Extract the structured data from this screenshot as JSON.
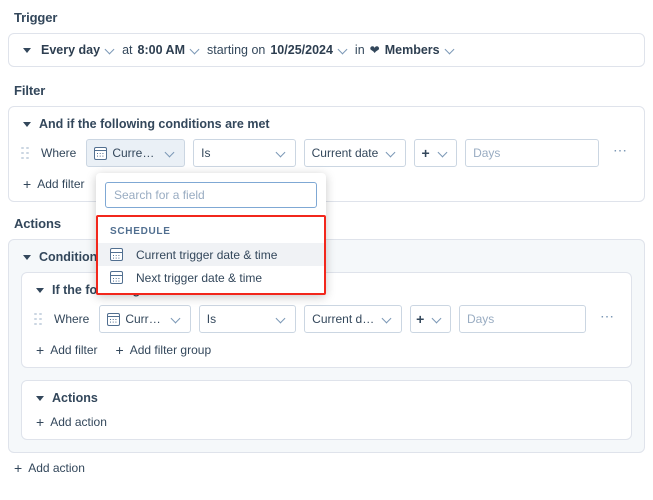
{
  "trigger": {
    "section_title": "Trigger",
    "frequency": "Every day",
    "at_label": "at",
    "time": "8:00 AM",
    "starting_on_label": "starting on",
    "date": "10/25/2024",
    "in_label": "in",
    "heart_icon": "heart-icon",
    "object": "Members"
  },
  "filter": {
    "section_title": "Filter",
    "group_header": "And if the following conditions are met",
    "row": {
      "where_label": "Where",
      "field": "Current trig...",
      "field_icon": "calendar-icon",
      "operator": "Is",
      "value": "Current date",
      "offset_sign": "+",
      "unit_placeholder": "Days",
      "more_icon": "ellipsis-icon"
    },
    "add_filter": "Add filter"
  },
  "dropdown": {
    "search_placeholder": "Search for a field",
    "search_value": "",
    "group_label": "SCHEDULE",
    "items": [
      {
        "label": "Current trigger date & time",
        "icon": "calendar-icon",
        "selected": true
      },
      {
        "label": "Next trigger date & time",
        "icon": "calendar-icon",
        "selected": false
      }
    ],
    "highlight_color": "#f2271c"
  },
  "actions": {
    "section_title": "Actions",
    "condition_card_header": "Condition",
    "inner_group_header": "If the following conditions are met",
    "row": {
      "where_label": "Where",
      "field": "Current trig...",
      "field_icon": "calendar-icon",
      "operator": "Is",
      "value": "Current date",
      "offset_sign": "+",
      "unit_placeholder": "Days",
      "more_icon": "ellipsis-icon"
    },
    "add_filter": "Add filter",
    "add_filter_group": "Add filter group",
    "actions_sub_header": "Actions",
    "add_action_inner": "Add action",
    "add_action_bottom": "Add action"
  }
}
